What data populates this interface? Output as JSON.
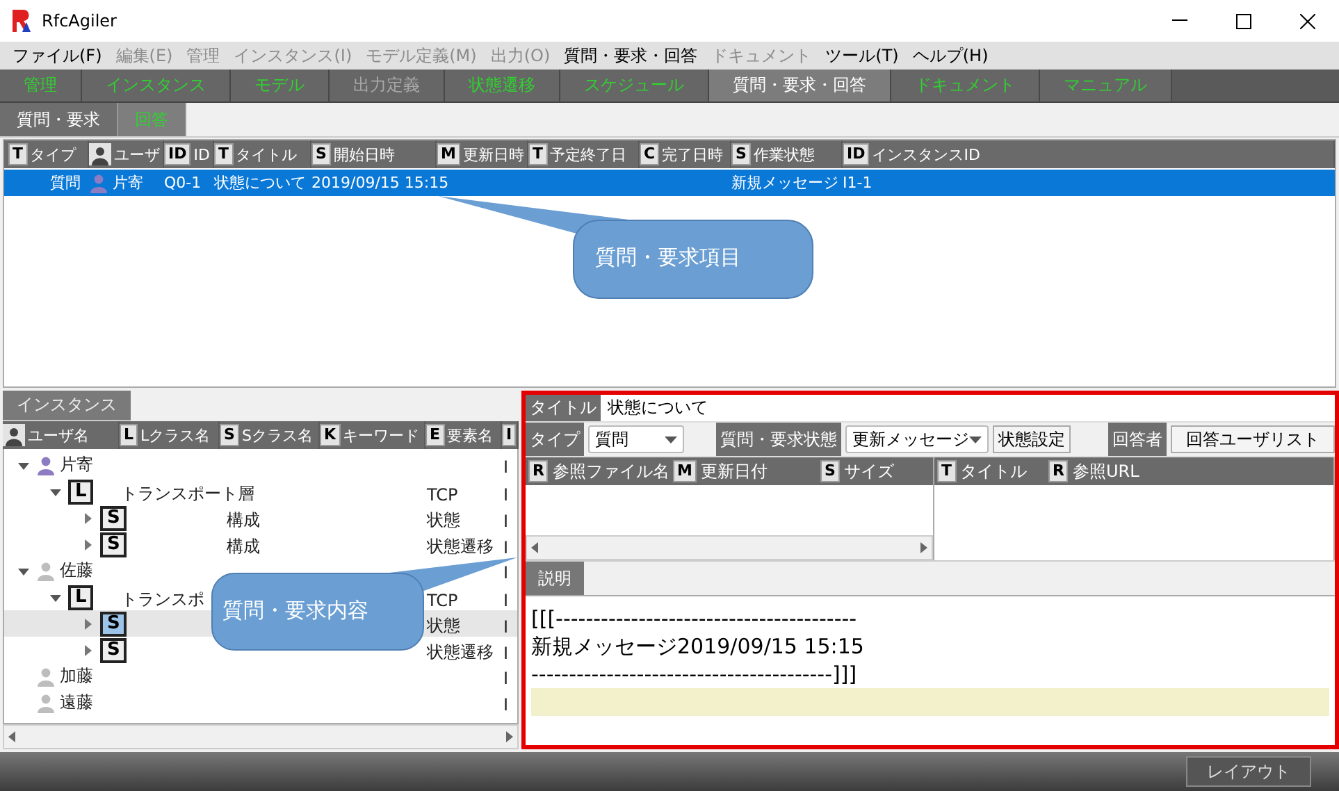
{
  "window": {
    "title": "RfcAgiler"
  },
  "menu": [
    {
      "label": "ファイル(F)",
      "disabled": false
    },
    {
      "label": "編集(E)",
      "disabled": true
    },
    {
      "label": "管理",
      "disabled": true
    },
    {
      "label": "インスタンス(I)",
      "disabled": true
    },
    {
      "label": "モデル定義(M)",
      "disabled": true
    },
    {
      "label": "出力(O)",
      "disabled": true
    },
    {
      "label": "質問・要求・回答",
      "disabled": false
    },
    {
      "label": "ドキュメント",
      "disabled": true
    },
    {
      "label": "ツール(T)",
      "disabled": false
    },
    {
      "label": "ヘルプ(H)",
      "disabled": false
    }
  ],
  "tabs": [
    {
      "label": "管理",
      "selected": false,
      "disabled": false
    },
    {
      "label": "インスタンス",
      "selected": false,
      "disabled": false
    },
    {
      "label": "モデル",
      "selected": false,
      "disabled": false
    },
    {
      "label": "出力定義",
      "selected": false,
      "disabled": true
    },
    {
      "label": "状態遷移",
      "selected": false,
      "disabled": false
    },
    {
      "label": "スケジュール",
      "selected": false,
      "disabled": false
    },
    {
      "label": "質問・要求・回答",
      "selected": true,
      "disabled": false
    },
    {
      "label": "ドキュメント",
      "selected": false,
      "disabled": false
    },
    {
      "label": "マニュアル",
      "selected": false,
      "disabled": false
    }
  ],
  "subtabs": [
    {
      "label": "質問・要求",
      "selected": true
    },
    {
      "label": "回答",
      "selected": false
    }
  ],
  "request_table": {
    "columns": [
      {
        "kind": "letter",
        "badge": "T",
        "label": "タイプ"
      },
      {
        "kind": "user",
        "label": "ユーザ"
      },
      {
        "kind": "letter",
        "badge": "ID",
        "label": "ID"
      },
      {
        "kind": "letter",
        "badge": "T",
        "label": "タイトル"
      },
      {
        "kind": "letter",
        "badge": "S",
        "label": "開始日時"
      },
      {
        "kind": "letter",
        "badge": "M",
        "label": "更新日時"
      },
      {
        "kind": "letter",
        "badge": "T",
        "label": "予定終了日"
      },
      {
        "kind": "letter",
        "badge": "C",
        "label": "完了日時"
      },
      {
        "kind": "letter",
        "badge": "S",
        "label": "作業状態"
      },
      {
        "kind": "letter",
        "badge": "ID",
        "label": "インスタンスID"
      }
    ],
    "rows": [
      {
        "selected": true,
        "type": "質問",
        "user": "片寄",
        "id": "Q0-1",
        "title": "状態について",
        "start": "2019/09/15 15:15",
        "status": "新規メッセージ",
        "instance": "I1-1"
      }
    ]
  },
  "callouts": [
    {
      "text": "質問・要求項目"
    },
    {
      "text": "質問・要求内容"
    }
  ],
  "instance_panel": {
    "tab": "インスタンス",
    "columns": [
      {
        "kind": "user",
        "label": "ユーザ名"
      },
      {
        "kind": "letter",
        "badge": "L",
        "label": "Lクラス名"
      },
      {
        "kind": "letter",
        "badge": "S",
        "label": "Sクラス名"
      },
      {
        "kind": "letter",
        "badge": "K",
        "label": "キーワード"
      },
      {
        "kind": "letter",
        "badge": "E",
        "label": "要素名"
      },
      {
        "kind": "letter",
        "badge": "I"
      }
    ],
    "tree": [
      {
        "kind": "user",
        "name": "片寄",
        "color": "#8e7cc3",
        "expanded": true,
        "selected": false,
        "column_6": "I",
        "children": [
          {
            "kind": "letter",
            "badge": "L",
            "lclass": "トランスポート層",
            "element": "TCP",
            "column_6": "I",
            "expanded": true,
            "selected": false,
            "children": [
              {
                "kind": "letter",
                "badge": "S",
                "sclass": "構成",
                "element": "状態",
                "column_6": "I",
                "expanded": false,
                "selected": false
              },
              {
                "kind": "letter",
                "badge": "S",
                "sclass": "構成",
                "element": "状態遷移",
                "column_6": "I",
                "expanded": false,
                "selected": false
              }
            ]
          }
        ]
      },
      {
        "kind": "user",
        "name": "佐藤",
        "color": "#bdbdbd",
        "expanded": true,
        "selected": false,
        "column_6": "I",
        "children": [
          {
            "kind": "letter",
            "badge": "L",
            "lclass": "トランスポ",
            "element": "TCP",
            "column_6": "I",
            "expanded": true,
            "selected": false,
            "children": [
              {
                "kind": "letter",
                "badge": "S",
                "element": "状態",
                "column_6": "I",
                "expanded": false,
                "selected": true
              },
              {
                "kind": "letter",
                "badge": "S",
                "element": "状態遷移",
                "column_6": "I",
                "expanded": false,
                "selected": false
              }
            ]
          }
        ]
      },
      {
        "kind": "user",
        "name": "加藤",
        "color": "#bdbdbd",
        "selected": false,
        "column_6": "I"
      },
      {
        "kind": "user",
        "name": "遠藤",
        "color": "#bdbdbd",
        "selected": false,
        "column_6": "I"
      }
    ]
  },
  "detail": {
    "title_label": "タイトル",
    "title_value": "状態について",
    "type_label": "タイプ",
    "type_value": "質問",
    "status_label": "質問・要求状態",
    "status_value": "更新メッセージ",
    "status_button": "状態設定",
    "responder_label": "回答者",
    "responder_button": "回答ユーザリスト",
    "files_columns": [
      {
        "badge": "R",
        "label": "参照ファイル名"
      },
      {
        "badge": "M",
        "label": "更新日付"
      },
      {
        "badge": "S",
        "label": "サイズ"
      }
    ],
    "links_columns": [
      {
        "badge": "T",
        "label": "タイトル"
      },
      {
        "badge": "R",
        "label": "参照URL"
      }
    ],
    "tabs": [
      {
        "label": "説明",
        "selected": true
      }
    ],
    "description_lines": [
      "[[[----------------------------------------",
      "新規メッセージ2019/09/15 15:15",
      "----------------------------------------]]]"
    ]
  },
  "status_bar": {
    "layout_button": "レイアウト"
  }
}
